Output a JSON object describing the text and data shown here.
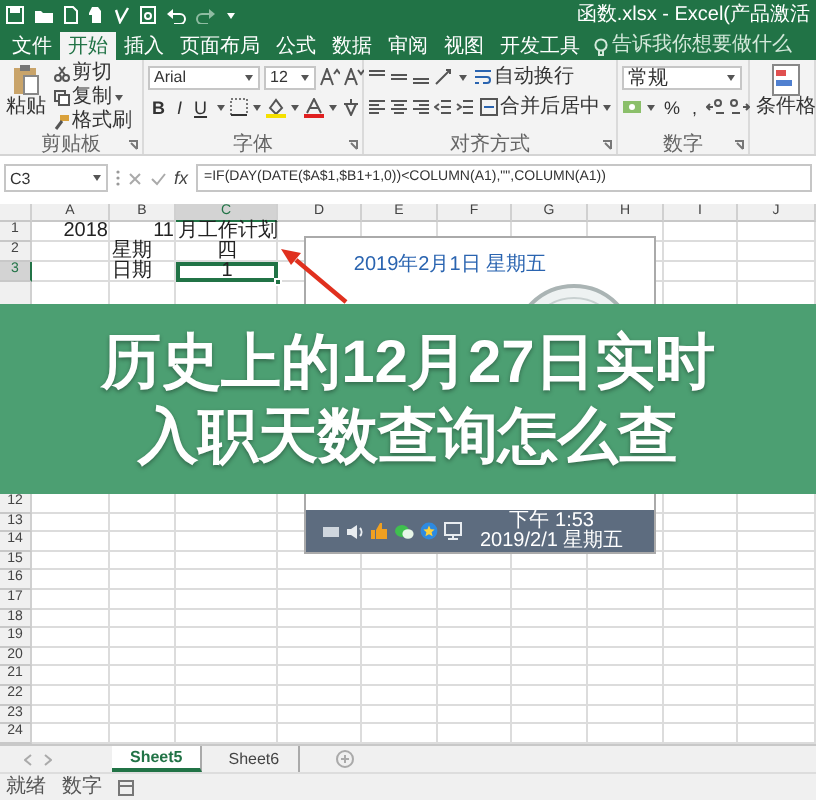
{
  "window": {
    "title": "函数.xlsx - Excel(产品激活"
  },
  "ribbon_tabs": [
    {
      "label": "文件",
      "selected": false
    },
    {
      "label": "开始",
      "selected": true
    },
    {
      "label": "插入",
      "selected": false
    },
    {
      "label": "页面布局",
      "selected": false
    },
    {
      "label": "公式",
      "selected": false
    },
    {
      "label": "数据",
      "selected": false
    },
    {
      "label": "审阅",
      "selected": false
    },
    {
      "label": "视图",
      "selected": false
    },
    {
      "label": "开发工具",
      "selected": false
    }
  ],
  "tell_me": {
    "placeholder": "告诉我你想要做什么"
  },
  "ribbon": {
    "clipboard": {
      "paste": "粘贴",
      "cut": "剪切",
      "copy": "复制",
      "format_painter": "格式刷",
      "label": "剪贴板"
    },
    "font": {
      "name": "Arial",
      "size": "12",
      "bold": "B",
      "italic": "I",
      "underline": "U",
      "label": "字体"
    },
    "alignment": {
      "wrap": "自动换行",
      "merge": "合并后居中",
      "label": "对齐方式"
    },
    "number": {
      "format": "常规",
      "percent": "%",
      "comma": ",",
      "label": "数字"
    },
    "styles": {
      "conditional": "条件格"
    }
  },
  "formula_bar": {
    "cell": "C3",
    "fx": "fx",
    "formula": "=IF(DAY(DATE($A$1,$B1+1,0))<COLUMN(A1),\"\",COLUMN(A1))"
  },
  "sheet": {
    "columns": [
      {
        "label": "A",
        "selected": false
      },
      {
        "label": "B",
        "selected": false
      },
      {
        "label": "C",
        "selected": true
      },
      {
        "label": "D",
        "selected": false
      },
      {
        "label": "E",
        "selected": false
      },
      {
        "label": "F",
        "selected": false
      },
      {
        "label": "G",
        "selected": false
      },
      {
        "label": "H",
        "selected": false
      },
      {
        "label": "I",
        "selected": false
      },
      {
        "label": "J",
        "selected": false
      }
    ],
    "rows_above_banner": [
      {
        "label": "1",
        "selected": false,
        "cells": [
          {
            "kind": "number",
            "text": "2018",
            "selected": false
          },
          {
            "kind": "number",
            "text": "11",
            "selected": false
          },
          {
            "kind": "text",
            "text": "月工作计划",
            "selected": false
          }
        ]
      },
      {
        "label": "2",
        "selected": false,
        "cells": [
          {
            "kind": "empty"
          },
          {
            "kind": "text",
            "text": "星期",
            "selected": false
          },
          {
            "kind": "centered",
            "text": "四",
            "selected": false
          }
        ]
      },
      {
        "label": "3",
        "selected": true,
        "cells": [
          {
            "kind": "empty"
          },
          {
            "kind": "text",
            "text": "日期",
            "selected": false
          },
          {
            "kind": "centered",
            "text": "1",
            "selected": true
          }
        ]
      }
    ],
    "rows_below_banner": [
      {
        "label": "12",
        "selected": false
      },
      {
        "label": "13",
        "selected": false
      },
      {
        "label": "14",
        "selected": false
      },
      {
        "label": "15",
        "selected": false
      },
      {
        "label": "16",
        "selected": false
      },
      {
        "label": "17",
        "selected": false
      },
      {
        "label": "18",
        "selected": false
      },
      {
        "label": "19",
        "selected": false
      },
      {
        "label": "20",
        "selected": false
      },
      {
        "label": "21",
        "selected": false
      },
      {
        "label": "22",
        "selected": false
      },
      {
        "label": "23",
        "selected": false
      },
      {
        "label": "24",
        "selected": false
      }
    ]
  },
  "calendar_popup": {
    "date_heading": "2019年2月1日 星期五",
    "time": "下午 1:53",
    "date": "2019/2/1 星期五"
  },
  "banner": {
    "lines": [
      "历史上的12月27日实时",
      "入职天数查询怎么查"
    ]
  },
  "sheet_tabs": [
    {
      "label": "Sheet5",
      "selected": true
    },
    {
      "label": "Sheet6",
      "selected": false
    }
  ],
  "status_bar": {
    "mode": "就绪",
    "indicator": "数字"
  }
}
